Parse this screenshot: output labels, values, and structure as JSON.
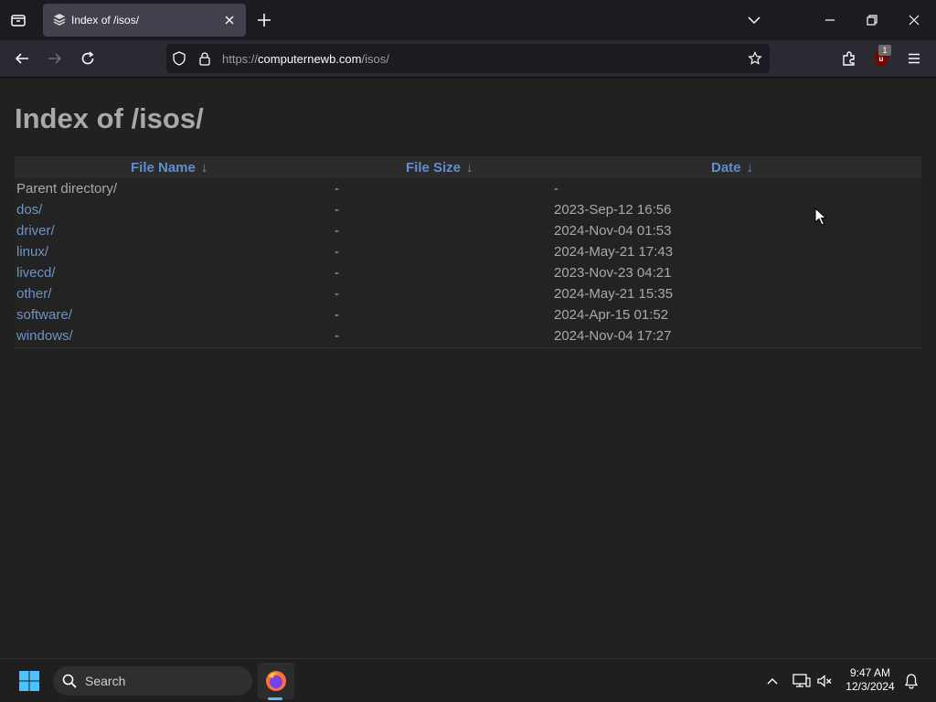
{
  "browser": {
    "tab_title": "Index of /isos/",
    "url_scheme": "https://",
    "url_host": "computernewb.com",
    "url_path": "/isos/",
    "extension_badge": "1"
  },
  "page": {
    "title": "Index of /isos/",
    "columns": {
      "name": "File Name",
      "size": "File Size",
      "date": "Date",
      "sort_arrow": "↓"
    },
    "rows": [
      {
        "name": "Parent directory/",
        "size": "-",
        "date": "-"
      },
      {
        "name": "dos/",
        "size": "-",
        "date": "2023-Sep-12 16:56"
      },
      {
        "name": "driver/",
        "size": "-",
        "date": "2024-Nov-04 01:53"
      },
      {
        "name": "linux/",
        "size": "-",
        "date": "2024-May-21 17:43"
      },
      {
        "name": "livecd/",
        "size": "-",
        "date": "2023-Nov-23 04:21"
      },
      {
        "name": "other/",
        "size": "-",
        "date": "2024-May-21 15:35"
      },
      {
        "name": "software/",
        "size": "-",
        "date": "2024-Apr-15 01:52"
      },
      {
        "name": "windows/",
        "size": "-",
        "date": "2024-Nov-04 17:27"
      }
    ]
  },
  "taskbar": {
    "search_placeholder": "Search",
    "time": "9:47 AM",
    "date": "12/3/2024"
  },
  "colors": {
    "link": "#6f93c4",
    "header_link": "#5f8fd0",
    "text_muted": "#a9a9a9",
    "page_bg": "#212121"
  }
}
